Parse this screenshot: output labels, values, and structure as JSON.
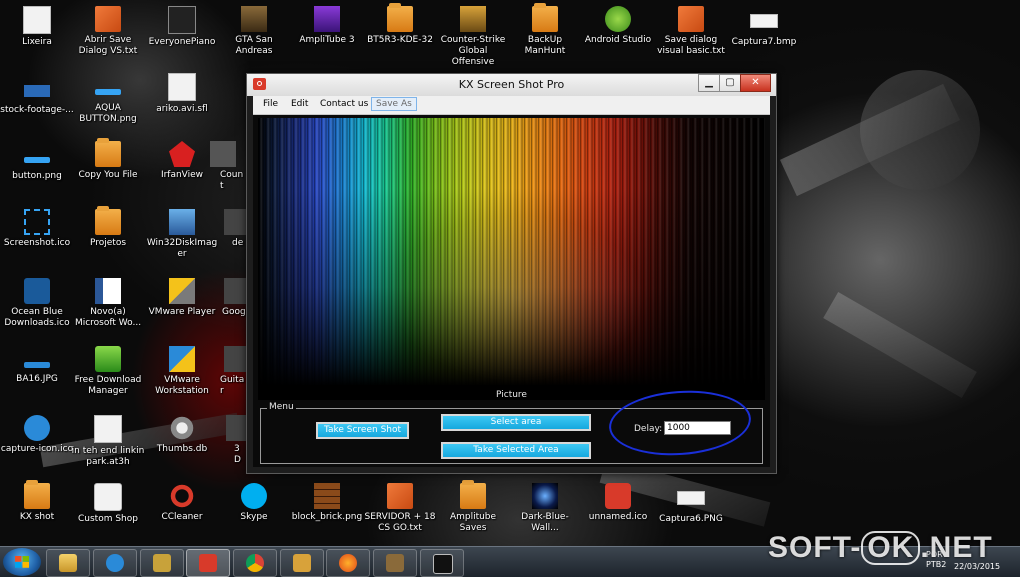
{
  "desktop": {
    "icons": [
      {
        "label": "Lixeira",
        "icon": "recycle-bin-icon"
      },
      {
        "label": "Abrir Save Dialog VS.txt",
        "icon": "text-file-icon"
      },
      {
        "label": "EveryonePiano",
        "icon": "piano-app-icon"
      },
      {
        "label": "GTA San Andreas",
        "icon": "gta-game-icon"
      },
      {
        "label": "AmpliTube 3",
        "icon": "amplitube-app-icon"
      },
      {
        "label": "BT5R3-KDE-32",
        "icon": "folder-icon"
      },
      {
        "label": "Counter-Strike Global Offensive",
        "icon": "csgo-game-icon"
      },
      {
        "label": "BackUp ManHunt",
        "icon": "folder-icon"
      },
      {
        "label": "Android Studio",
        "icon": "android-studio-icon"
      },
      {
        "label": "Save dialog visual basic.txt",
        "icon": "text-file-icon"
      },
      {
        "label": "Captura7.bmp",
        "icon": "image-file-icon"
      },
      {
        "label": "stock-footage-...",
        "icon": "video-file-icon"
      },
      {
        "label": "AQUA BUTTON.png",
        "icon": "image-file-icon"
      },
      {
        "label": "ariko.avi.sfl",
        "icon": "generic-file-icon"
      },
      {
        "label": "button.png",
        "icon": "image-file-icon"
      },
      {
        "label": "Copy You File",
        "icon": "folder-icon"
      },
      {
        "label": "IrfanView",
        "icon": "irfanview-app-icon"
      },
      {
        "label": "Count",
        "icon": "generic-file-icon"
      },
      {
        "label": "Screenshot.ico",
        "icon": "screenshot-icon"
      },
      {
        "label": "Projetos",
        "icon": "folder-icon"
      },
      {
        "label": "Win32DiskImager",
        "icon": "disk-imager-icon"
      },
      {
        "label": "de",
        "icon": "generic-file-icon"
      },
      {
        "label": "Ocean Blue Downloads.ico",
        "icon": "download-icon"
      },
      {
        "label": "Novo(a) Microsoft Wo...",
        "icon": "word-document-icon"
      },
      {
        "label": "VMware Player",
        "icon": "vmware-icon"
      },
      {
        "label": "Goog",
        "icon": "generic-file-icon"
      },
      {
        "label": "BA16.JPG",
        "icon": "image-file-icon"
      },
      {
        "label": "Free Download Manager",
        "icon": "download-manager-icon"
      },
      {
        "label": "VMware Workstation",
        "icon": "vmware-icon"
      },
      {
        "label": "Guitar",
        "icon": "generic-file-icon"
      },
      {
        "label": "capture-icon.ico",
        "icon": "camera-icon"
      },
      {
        "label": "in teh end linkin park.at3h",
        "icon": "generic-file-icon"
      },
      {
        "label": "Thumbs.db",
        "icon": "gear-file-icon"
      },
      {
        "label": "3D",
        "icon": "generic-file-icon"
      },
      {
        "label": "KX shot",
        "icon": "folder-icon"
      },
      {
        "label": "Custom Shop",
        "icon": "guitar-app-icon"
      },
      {
        "label": "CCleaner",
        "icon": "ccleaner-icon"
      },
      {
        "label": "Skype",
        "icon": "skype-icon"
      },
      {
        "label": "block_brick.png",
        "icon": "image-file-icon"
      },
      {
        "label": "SERVIDOR + 18 CS GO.txt",
        "icon": "text-file-icon"
      },
      {
        "label": "Amplitube Saves",
        "icon": "folder-icon"
      },
      {
        "label": "Dark-Blue-Wall...",
        "icon": "image-file-icon"
      },
      {
        "label": "unnamed.ico",
        "icon": "camera-icon"
      },
      {
        "label": "Captura6.PNG",
        "icon": "image-file-icon"
      }
    ]
  },
  "window": {
    "title": "KX Screen Shot Pro",
    "min_glyph": "▁",
    "max_glyph": "▢",
    "close_glyph": "✕",
    "menu": {
      "file": "File",
      "edit": "Edit",
      "contact": "Contact us",
      "save_as": "Save As"
    },
    "picture_label": "Picture",
    "group_title": "Menu",
    "buttons": {
      "take": "Take Screen Shot",
      "select": "Select area",
      "take_selected": "Take Selected Area"
    },
    "delay_label": "Delay:",
    "delay_value": "1000"
  },
  "taskbar": {
    "apps": [
      {
        "icon": "file-explorer-icon",
        "active": false
      },
      {
        "icon": "tgc-app-icon",
        "active": false
      },
      {
        "icon": "counter-strike-icon",
        "active": false
      },
      {
        "icon": "kx-screenshot-icon",
        "active": true
      },
      {
        "icon": "chrome-icon",
        "active": false
      },
      {
        "icon": "csgo-icon",
        "active": false
      },
      {
        "icon": "firefox-icon",
        "active": false
      },
      {
        "icon": "gta-icon",
        "active": false
      },
      {
        "icon": "udk-icon",
        "active": false
      }
    ],
    "tray_line1": "POR",
    "tray_line2": "PTB2",
    "clock_date": "22/03/2015"
  },
  "watermark": {
    "left": "SOFT-",
    "ok": "OK",
    "right": ".NET"
  },
  "colors": {
    "accent_button": "#16a8de",
    "highlight_ellipse": "#1a2fd8",
    "close_button": "#c8321f"
  }
}
